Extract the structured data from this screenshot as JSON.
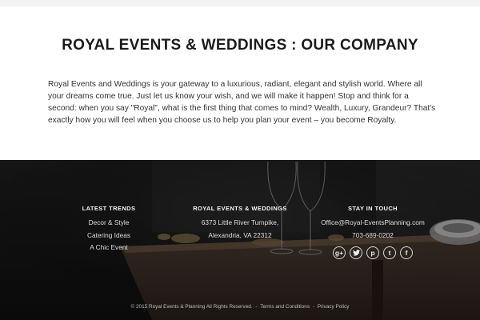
{
  "company": {
    "title": "ROYAL EVENTS & WEDDINGS : OUR COMPANY",
    "text": "Royal Events and Weddings is your gateway to a luxurious, radiant, elegant and stylish world. Where all your dreams come true. Just let us know your wish, and we will make it happen! Stop and think for a second: when you say \"Royal\", what is the first thing that comes to mind? Wealth, Luxury, Grandeur? That's exactly how you will feel when you choose us to help you plan your event – you become Royalty."
  },
  "footer": {
    "trends": {
      "heading": "LATEST TRENDS",
      "items": [
        "Decor & Style",
        "Catering Ideas",
        "A Chic Event"
      ]
    },
    "contact": {
      "heading": "ROYAL EVENTS & WEDDINGS",
      "street": "6373 Little River Turnpike,",
      "city": "Alexandria, VA 22312"
    },
    "touch": {
      "heading": "STAY IN TOUCH",
      "email": "Office@Royal-EventsPlanning.com",
      "phone": "703-689-0202",
      "social": [
        {
          "name": "google-plus-icon",
          "glyph": "g+"
        },
        {
          "name": "twitter-icon",
          "glyph": ""
        },
        {
          "name": "pinterest-icon",
          "glyph": "p"
        },
        {
          "name": "tumblr-icon",
          "glyph": "t"
        },
        {
          "name": "facebook-icon",
          "glyph": "f"
        }
      ]
    },
    "bottom": {
      "copyright": "© 2015 Royal Events & Planning All Rights Reserved.",
      "separator": "-",
      "terms": "Terms and Conditions",
      "privacy": "Privacy Policy"
    }
  },
  "colors": {
    "heading": "#1b1b1b",
    "body_text": "#333333",
    "footer_bg": "#141414",
    "footer_text": "#dedede"
  }
}
